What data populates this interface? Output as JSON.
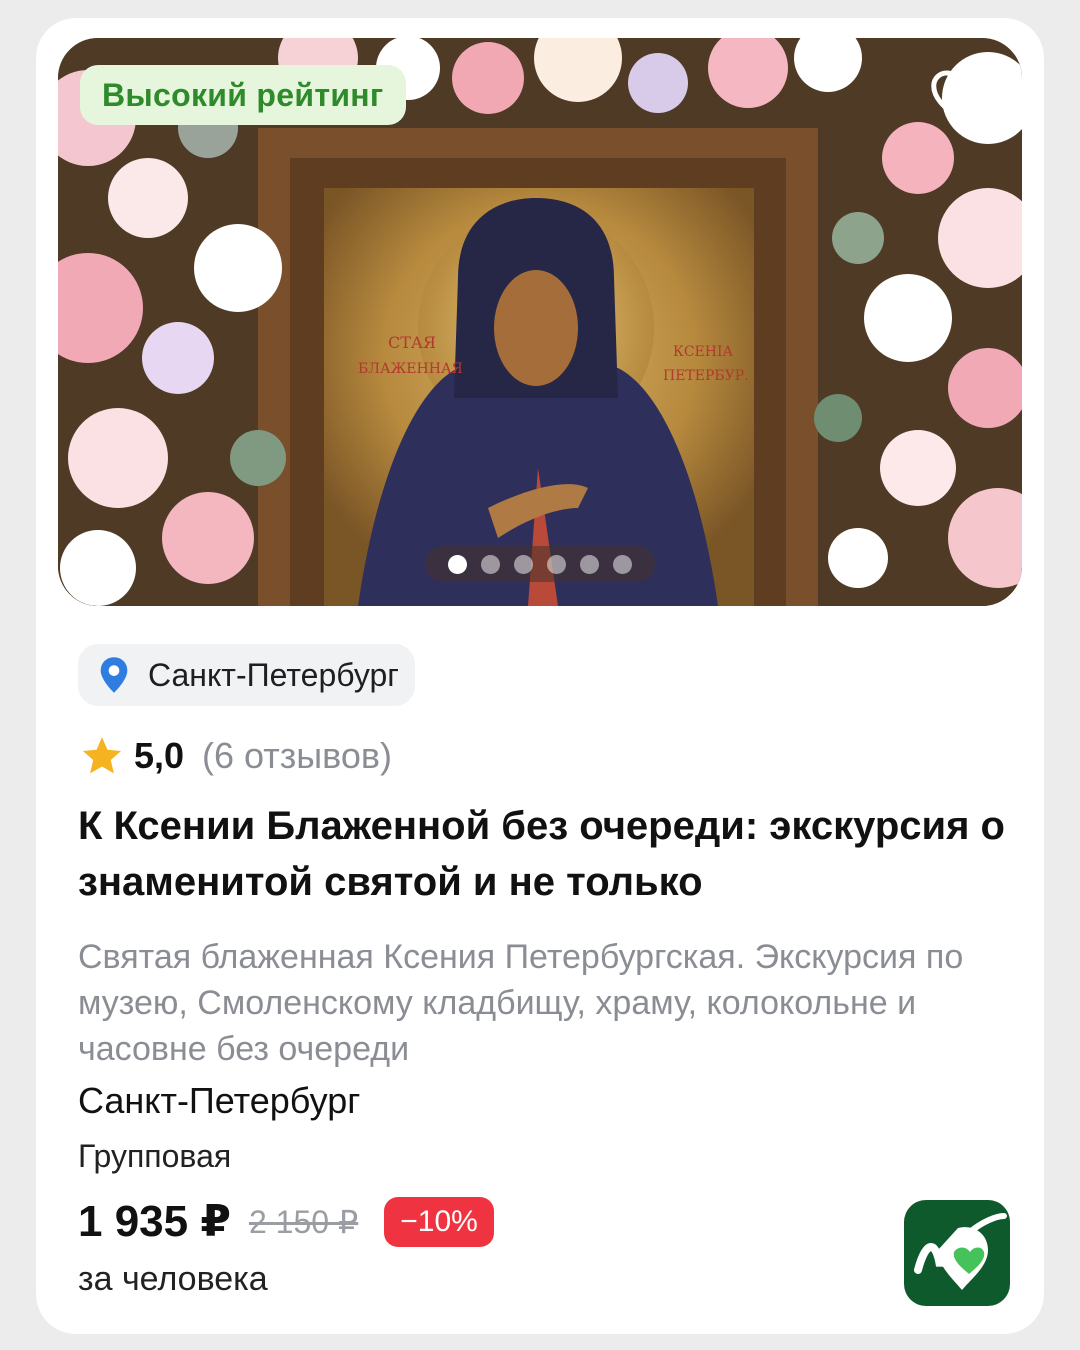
{
  "badge": {
    "label": "Высокий рейтинг",
    "color": "#2f8a2b",
    "bg": "#e6f6dc"
  },
  "favorite_icon": "heart-outline-icon",
  "gallery": {
    "total": 6,
    "active": 1
  },
  "location_chip": {
    "icon": "location-pin-icon",
    "label": "Санкт-Петербург",
    "icon_color": "#2f7de1"
  },
  "rating": {
    "score": "5,0",
    "reviews": "(6 отзывов)",
    "star_color": "#f5b322"
  },
  "title": "К Ксении Блаженной без очереди: экскурсия о знаменитой святой и не только",
  "description": "Святая блаженная Ксения Петербургская. Экскурсия по музею, Смоленскому кладбищу, храму, колокольне и часовне без очереди",
  "city": "Санкт-Петербург",
  "type": "Групповая",
  "price": {
    "current": "1 935 ₽",
    "old": "2 150 ₽",
    "discount": "−10%",
    "unit": "за человека",
    "discount_color": "#ef3340"
  },
  "brand_icon": "tripster-logo-icon"
}
